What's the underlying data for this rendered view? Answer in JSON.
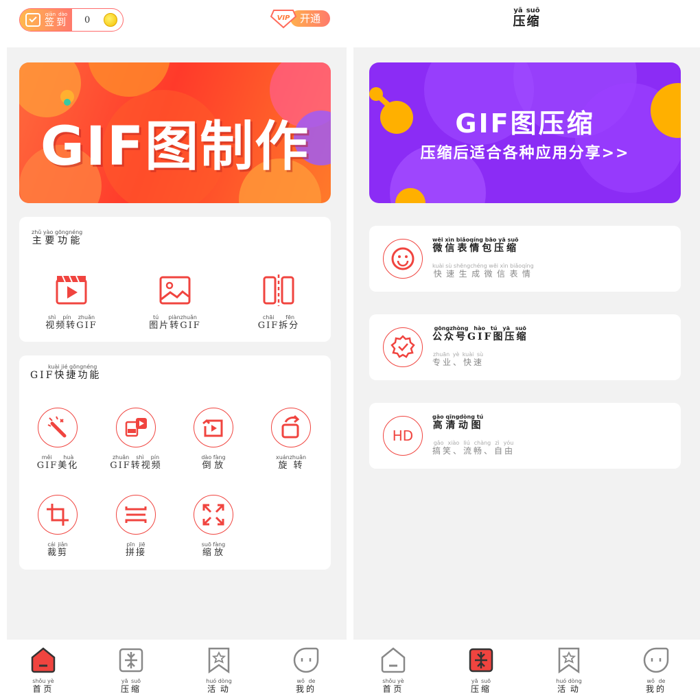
{
  "left": {
    "checkin": {
      "pinyin": "qiān dào",
      "label": "签到",
      "count": "0"
    },
    "vip": {
      "badge": "VIP",
      "label": "开通"
    },
    "banner": {
      "title": "GIF图制作"
    },
    "main_section": {
      "pinyin": "zhǔ yào gōngnéng",
      "title": "主要功能",
      "items": [
        {
          "pinyin": "shì pín zhuǎn",
          "label": "视频转GIF",
          "icon": "video-clapper-icon"
        },
        {
          "pinyin": "tú piànzhuǎn",
          "label": "图片转GIF",
          "icon": "image-icon"
        },
        {
          "pinyin": "chāi fēn",
          "label": "GIF拆分",
          "icon": "split-icon"
        }
      ]
    },
    "quick_section": {
      "pinyin": "kuài jié gōngnéng",
      "title": "GIF快捷功能",
      "items": [
        {
          "pinyin": "měi huà",
          "label": "GIF美化",
          "icon": "magic-wand-icon"
        },
        {
          "pinyin": "zhuǎn shì pín",
          "label": "GIF转视频",
          "icon": "gif-to-video-icon"
        },
        {
          "pinyin": "dào fàng",
          "label": "倒放",
          "icon": "reverse-play-icon"
        },
        {
          "pinyin": "xuánzhuǎn",
          "label": "旋转",
          "icon": "rotate-icon"
        },
        {
          "pinyin": "cái jiǎn",
          "label": "裁剪",
          "icon": "crop-icon"
        },
        {
          "pinyin": "pīn jiē",
          "label": "拼接",
          "icon": "stitch-icon"
        },
        {
          "pinyin": "suō fàng",
          "label": "缩放",
          "icon": "scale-icon"
        }
      ]
    },
    "tabs": [
      {
        "pinyin": "shǒu yè",
        "label": "首页",
        "active": true
      },
      {
        "pinyin": "yā suō",
        "label": "压缩",
        "active": false
      },
      {
        "pinyin": "huó dòng",
        "label": "活动",
        "active": false
      },
      {
        "pinyin": "wǒ de",
        "label": "我的",
        "active": false
      }
    ]
  },
  "right": {
    "header": {
      "pinyin": "yā suō",
      "title": "压缩"
    },
    "banner": {
      "title": "GIF图压缩",
      "subtitle": "压缩后适合各种应用分享>>"
    },
    "rows": [
      {
        "icon": "smiley-icon",
        "title_pinyin": "wēi xìn biǎoqíng bāo yā suō",
        "title": "微信表情包压缩",
        "desc_pinyin": "kuài sù shēngchéng wēi xìn biǎoqíng",
        "desc": "快速生成微信表情"
      },
      {
        "icon": "verified-badge-icon",
        "title_pinyin": "gōngzhòng hào tú yā suō",
        "title": "公众号GIF图压缩",
        "desc_pinyin": "zhuān yè kuài sù",
        "desc": "专业、快速"
      },
      {
        "icon": "hd-icon",
        "hd_text": "HD",
        "title_pinyin": "gāo qīngdòng tú",
        "title": "高清动图",
        "desc_pinyin": "gǎo xiào liú chàng zì yóu",
        "desc": "搞笑、流畅、自由"
      }
    ],
    "tabs": [
      {
        "pinyin": "shǒu yè",
        "label": "首页",
        "active": false
      },
      {
        "pinyin": "yā suō",
        "label": "压缩",
        "active": true
      },
      {
        "pinyin": "huó dòng",
        "label": "活动",
        "active": false
      },
      {
        "pinyin": "wǒ de",
        "label": "我的",
        "active": false
      }
    ]
  },
  "colors": {
    "accent": "#f0443f",
    "banner_purple": "#8b2cf5",
    "banner_red": "#ff3a2a",
    "bg": "#f2f2f2"
  }
}
